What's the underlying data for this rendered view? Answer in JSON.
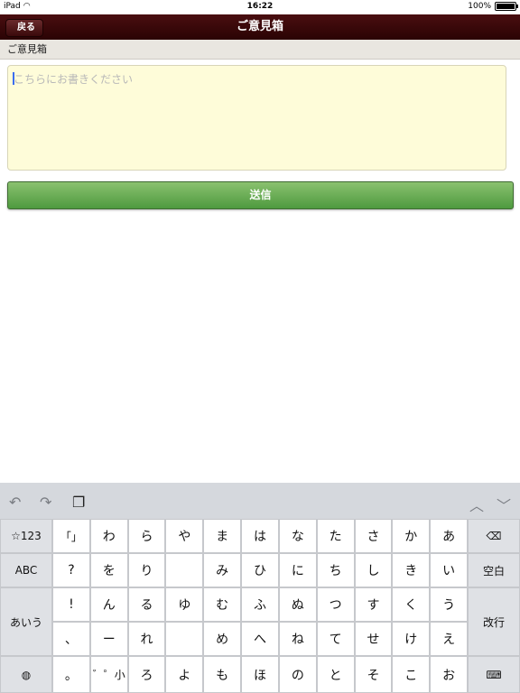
{
  "status": {
    "device": "iPad",
    "time": "16:22",
    "battery_text": "100%",
    "battery_level": 1.0
  },
  "nav": {
    "back_label": "戻る",
    "title": "ご意見箱"
  },
  "section": {
    "label": "ご意見箱"
  },
  "input": {
    "placeholder": "こちらにお書きください",
    "value": ""
  },
  "submit": {
    "label": "送信"
  },
  "keyboard": {
    "toolbar": {
      "undo": "↶",
      "redo": "↷",
      "paste": "❐",
      "up": "︿",
      "down": "﹀"
    },
    "left": {
      "num": "☆123",
      "abc": "ABC",
      "kana": "あいう",
      "globe": "🌐"
    },
    "right": {
      "backspace": "⌫",
      "space": "空白",
      "enter": "改行",
      "hide": "⌨"
    },
    "cols": [
      [
        "「」",
        "?",
        "!",
        "、",
        "。"
      ],
      [
        "わ",
        "を",
        "ん",
        "ー",
        "゛゜小"
      ],
      [
        "ら",
        "り",
        "る",
        "れ",
        "ろ"
      ],
      [
        "や",
        "",
        "ゆ",
        "",
        "よ"
      ],
      [
        "ま",
        "み",
        "む",
        "め",
        "も"
      ],
      [
        "は",
        "ひ",
        "ふ",
        "へ",
        "ほ"
      ],
      [
        "な",
        "に",
        "ぬ",
        "ね",
        "の"
      ],
      [
        "た",
        "ち",
        "つ",
        "て",
        "と"
      ],
      [
        "さ",
        "し",
        "す",
        "せ",
        "そ"
      ],
      [
        "か",
        "き",
        "く",
        "け",
        "こ"
      ],
      [
        "あ",
        "い",
        "う",
        "え",
        "お"
      ]
    ]
  }
}
